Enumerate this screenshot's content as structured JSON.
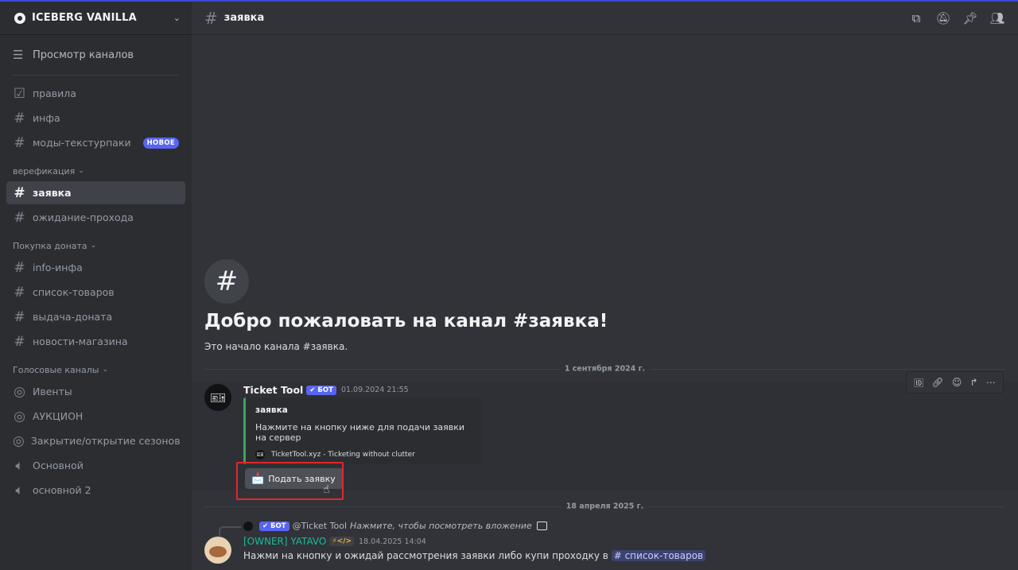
{
  "server": {
    "name": "ICEBERG VANILLA"
  },
  "browse": {
    "label": "Просмотр каналов"
  },
  "sidebar": {
    "top_channels": [
      {
        "label": "правила",
        "icon": "rules-icon"
      },
      {
        "label": "инфа",
        "icon": "hash-icon"
      },
      {
        "label": "моды-текстурпаки",
        "icon": "hash-icon",
        "badge": "НОВОЕ"
      }
    ],
    "categories": [
      {
        "name": "верефикация",
        "channels": [
          {
            "label": "заявка",
            "active": true
          },
          {
            "label": "ожидание-прохода"
          }
        ]
      },
      {
        "name": "Покупка доната",
        "channels": [
          {
            "label": "info-инфа"
          },
          {
            "label": "список-товаров"
          },
          {
            "label": "выдача-доната"
          },
          {
            "label": "новости-магазина"
          }
        ]
      },
      {
        "name": "Голосовые каналы",
        "channels": [
          {
            "label": "Ивенты",
            "icon": "stage-icon"
          },
          {
            "label": "АУКЦИОН",
            "icon": "stage-icon"
          },
          {
            "label": "Закрытие/открытие сезонов",
            "icon": "stage-icon"
          },
          {
            "label": "Основной",
            "icon": "speaker-icon"
          },
          {
            "label": "основной 2",
            "icon": "speaker-icon"
          }
        ]
      }
    ]
  },
  "channel": {
    "title": "заявка",
    "welcome_title": "Добро пожаловать на канал #заявка!",
    "welcome_sub": "Это начало канала #заявка."
  },
  "dates": {
    "first": "1 сентября 2024 г.",
    "second": "18 апреля 2025 г."
  },
  "message1": {
    "author": "Ticket Tool",
    "bot_tag": "✔ БОТ",
    "timestamp": "01.09.2024 21:55",
    "embed": {
      "title": "заявка",
      "description": "Нажмите на кнопку ниже для подачи заявки на сервер",
      "footer": "TicketTool.xyz - Ticketing without clutter"
    },
    "button": "Подать заявку"
  },
  "message2": {
    "reply_bot_tag": "✔ БОТ",
    "reply_author": "@Ticket Tool",
    "reply_text": "Нажмите, чтобы посмотреть вложение",
    "author": "[OWNER] YATAVO",
    "dev_tag": "⚡</>",
    "timestamp": "18.04.2025 14:04",
    "text": "Нажми на кнопку и ожидай рассмотрения заявки либо купи проходку в",
    "mention": "# список-товаров"
  },
  "colors": {
    "accent": "#5865f2",
    "embed_bar": "#3ba55c",
    "highlight": "#e3262c",
    "owner_name": "#1abc9c"
  }
}
